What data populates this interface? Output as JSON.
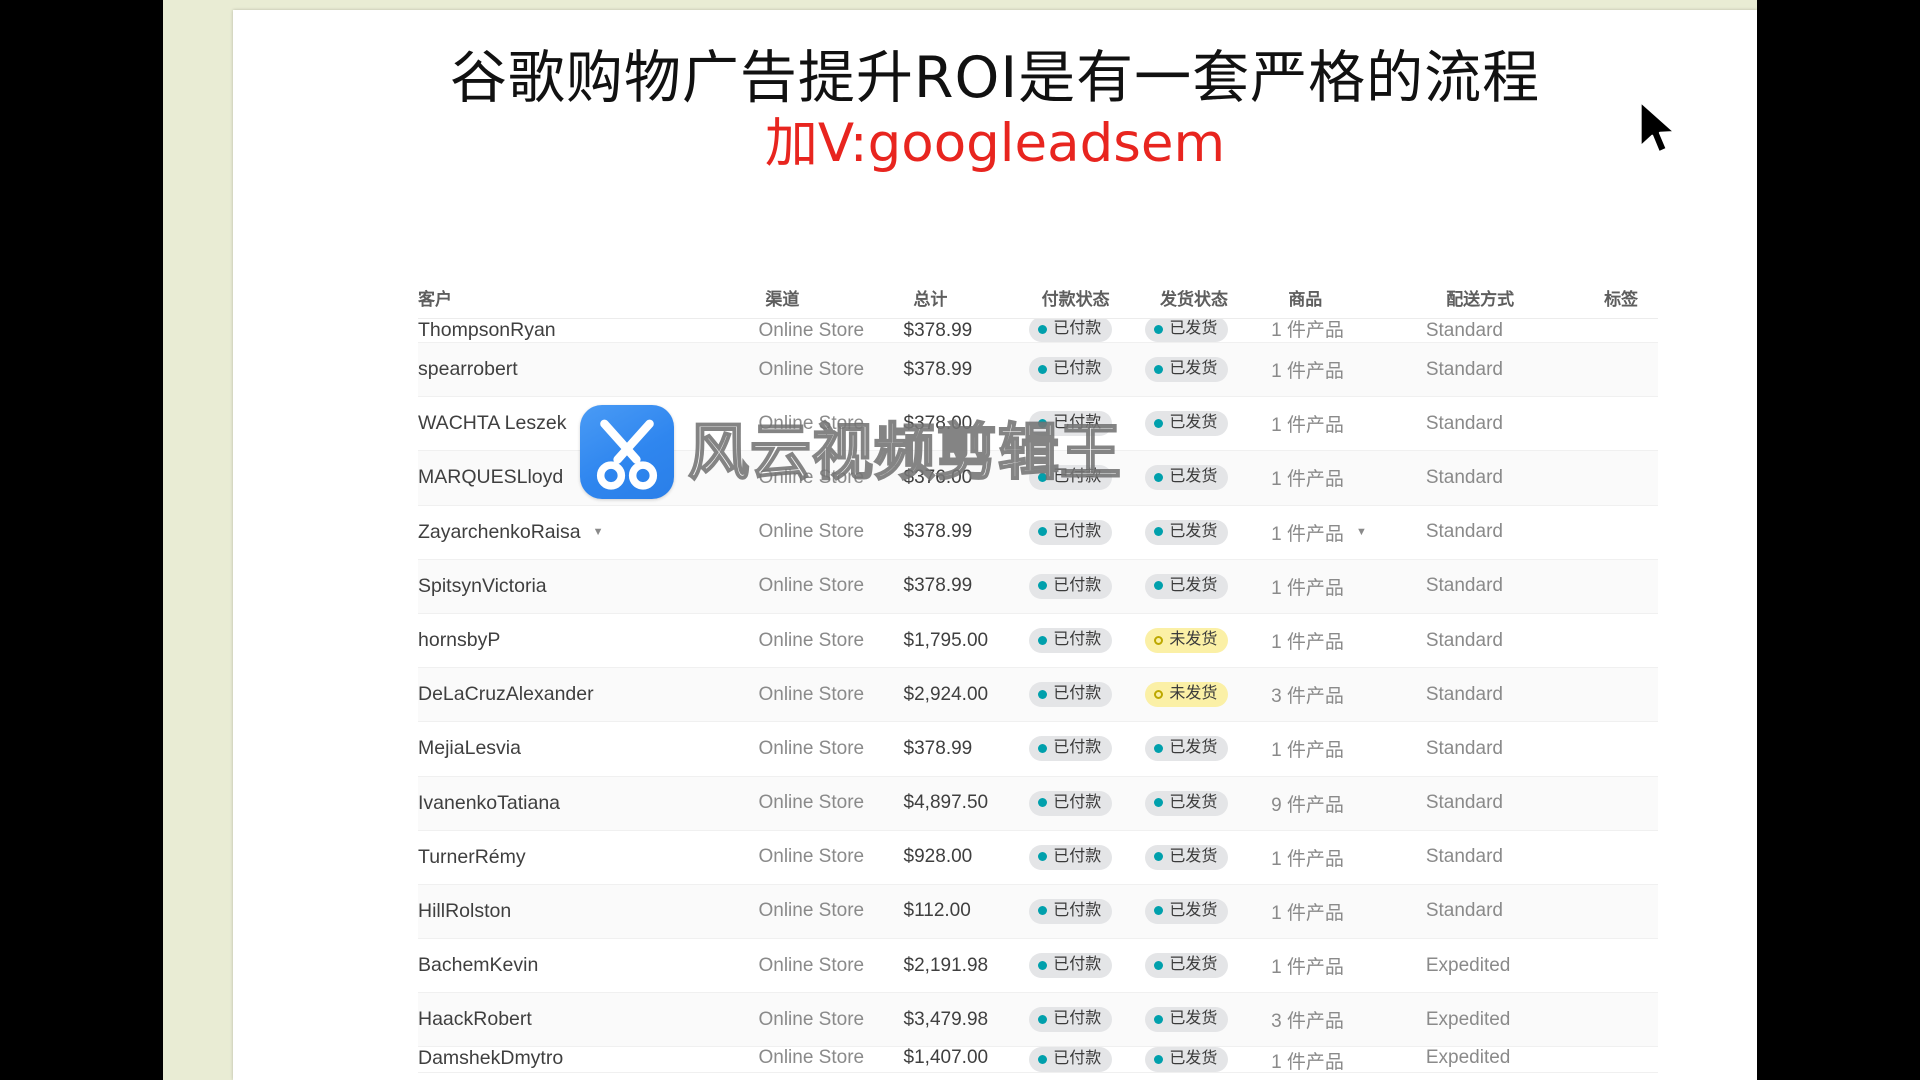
{
  "slide": {
    "title_main": "谷歌购物广告提升ROI是有一套严格的流程",
    "title_sub": "加V:googleadsem"
  },
  "watermark": {
    "text": "风云视频剪辑王",
    "icon": "scissors-icon"
  },
  "table": {
    "headers": {
      "customer": "客户",
      "channel": "渠道",
      "total": "总计",
      "payment_status": "付款状态",
      "fulfillment_status": "发货状态",
      "items": "商品",
      "delivery_method": "配送方式",
      "tags": "标签"
    },
    "badges": {
      "paid": "已付款",
      "fulfilled": "已发货",
      "unfulfilled": "未发货"
    },
    "colors": {
      "badge_grey": "#e4e5e7",
      "badge_yellow": "#fbf0a6",
      "dot_teal": "#00a0ac",
      "dot_hollow_border": "#bda800",
      "title_red": "#e8251f"
    },
    "rows": [
      {
        "customer": "ThompsonRyan",
        "channel": "Online Store",
        "total": "$378.99",
        "payment": "已付款",
        "fulfillment": "已发货",
        "fulfillment_type": "grey",
        "items": "1 件产品",
        "method": "Standard",
        "tag": "",
        "clip": "top"
      },
      {
        "customer": "spearrobert",
        "channel": "Online Store",
        "total": "$378.99",
        "payment": "已付款",
        "fulfillment": "已发货",
        "fulfillment_type": "grey",
        "items": "1 件产品",
        "method": "Standard",
        "tag": ""
      },
      {
        "customer": "WACHTA Leszek",
        "channel": "Online Store",
        "total": "$378.00",
        "payment": "已付款",
        "fulfillment": "已发货",
        "fulfillment_type": "grey",
        "items": "1 件产品",
        "method": "Standard",
        "tag": ""
      },
      {
        "customer": "MARQUESLloyd",
        "channel": "Online Store",
        "total": "$376.00",
        "payment": "已付款",
        "fulfillment": "已发货",
        "fulfillment_type": "grey",
        "items": "1 件产品",
        "method": "Standard",
        "tag": ""
      },
      {
        "customer": "ZayarchenkoRaisa",
        "channel": "Online Store",
        "total": "$378.99",
        "payment": "已付款",
        "fulfillment": "已发货",
        "fulfillment_type": "grey",
        "items": "1 件产品",
        "method": "Standard",
        "tag": "",
        "caret": true
      },
      {
        "customer": "SpitsynVictoria",
        "channel": "Online Store",
        "total": "$378.99",
        "payment": "已付款",
        "fulfillment": "已发货",
        "fulfillment_type": "grey",
        "items": "1 件产品",
        "method": "Standard",
        "tag": ""
      },
      {
        "customer": "hornsbyP",
        "channel": "Online Store",
        "total": "$1,795.00",
        "payment": "已付款",
        "fulfillment": "未发货",
        "fulfillment_type": "yellow",
        "items": "1 件产品",
        "method": "Standard",
        "tag": ""
      },
      {
        "customer": "DeLaCruzAlexander",
        "channel": "Online Store",
        "total": "$2,924.00",
        "payment": "已付款",
        "fulfillment": "未发货",
        "fulfillment_type": "yellow",
        "items": "3 件产品",
        "method": "Standard",
        "tag": ""
      },
      {
        "customer": "MejiaLesvia",
        "channel": "Online Store",
        "total": "$378.99",
        "payment": "已付款",
        "fulfillment": "已发货",
        "fulfillment_type": "grey",
        "items": "1 件产品",
        "method": "Standard",
        "tag": ""
      },
      {
        "customer": "IvanenkoTatiana",
        "channel": "Online Store",
        "total": "$4,897.50",
        "payment": "已付款",
        "fulfillment": "已发货",
        "fulfillment_type": "grey",
        "items": "9 件产品",
        "method": "Standard",
        "tag": ""
      },
      {
        "customer": "TurnerRémy",
        "channel": "Online Store",
        "total": "$928.00",
        "payment": "已付款",
        "fulfillment": "已发货",
        "fulfillment_type": "grey",
        "items": "1 件产品",
        "method": "Standard",
        "tag": ""
      },
      {
        "customer": "HillRolston",
        "channel": "Online Store",
        "total": "$112.00",
        "payment": "已付款",
        "fulfillment": "已发货",
        "fulfillment_type": "grey",
        "items": "1 件产品",
        "method": "Standard",
        "tag": ""
      },
      {
        "customer": "BachemKevin",
        "channel": "Online Store",
        "total": "$2,191.98",
        "payment": "已付款",
        "fulfillment": "已发货",
        "fulfillment_type": "grey",
        "items": "1 件产品",
        "method": "Expedited",
        "tag": ""
      },
      {
        "customer": "HaackRobert",
        "channel": "Online Store",
        "total": "$3,479.98",
        "payment": "已付款",
        "fulfillment": "已发货",
        "fulfillment_type": "grey",
        "items": "3 件产品",
        "method": "Expedited",
        "tag": ""
      },
      {
        "customer": "DamshekDmytro",
        "channel": "Online Store",
        "total": "$1,407.00",
        "payment": "已付款",
        "fulfillment": "已发货",
        "fulfillment_type": "grey",
        "items": "1 件产品",
        "method": "Expedited",
        "tag": "",
        "clip": "bottom"
      }
    ]
  },
  "cursor": {
    "type": "arrow-pointer"
  }
}
